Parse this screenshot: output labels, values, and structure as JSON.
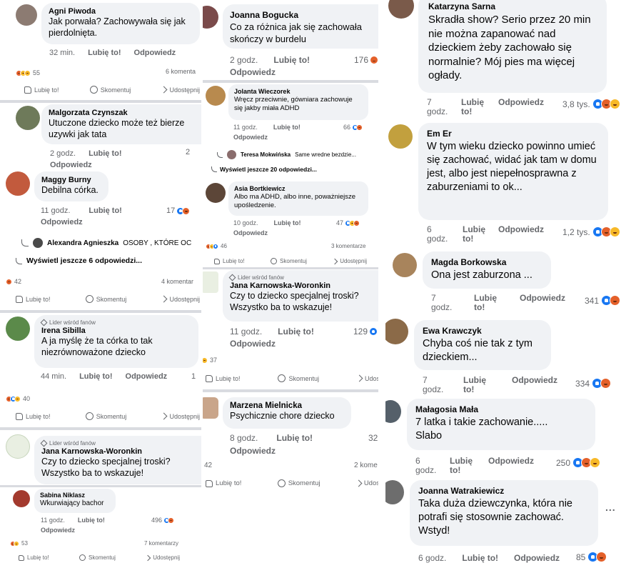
{
  "common": {
    "like_label": "Lubię to!",
    "reply_label": "Odpowiedz",
    "comment_label": "Skomentuj",
    "share_label": "Udostępnij",
    "fan_badge": "Lider wśród fanów"
  },
  "comments": {
    "agni": {
      "name": "Agni Piwoda",
      "text": "Jak porwała? Zachowywała się jak pierdolnięta.",
      "time": "32 min."
    },
    "malgorzata": {
      "name": "Malgorzata Czynszak",
      "text": "Utuczone dziecko może też bierze uzywki jak tata",
      "time": "2 godz."
    },
    "maggy": {
      "name": "Maggy Burny",
      "text": "Debilna córka.",
      "time": "11 godz.",
      "count": "17"
    },
    "alexandra": {
      "name": "Alexandra Agnieszka",
      "text": "OSOBY , KTÓRE OC"
    },
    "irena": {
      "name": "Irena Sibilla",
      "text": "A ja myślę że ta córka to tak niezrównoważone dziecko",
      "time": "44 min.",
      "count": "1"
    },
    "jana_left": {
      "name": "Jana Karnowska-Woronkin",
      "text": "Czy to dziecko specjalnej troski? Wszystko ba to wskazuje!"
    },
    "sabina": {
      "name": "Sabina Niklasz",
      "text": "Wkurwiający bachor",
      "time": "11 godz.",
      "count": "496"
    },
    "joanna_b": {
      "name": "Joanna Bogucka",
      "text": "Co za różnica jak się zachowała skończy w burdelu",
      "time": "2 godz.",
      "count": "176"
    },
    "jolanta": {
      "name": "Jolanta Wieczorek",
      "text": "Wręcz przeciwnie, gówniara zachowuje się jakby miała ADHD",
      "time": "11 godz.",
      "count": "66"
    },
    "teresa": {
      "name": "Teresa Mokwińska",
      "text": "Same wredne bezdzie..."
    },
    "asia": {
      "name": "Asia Bortkiewicz",
      "text": "Albo ma ADHD, albo inne, poważniejsze upośledzenie.",
      "time": "10 godz.",
      "count": "47"
    },
    "jana_mid": {
      "name": "Jana Karnowska-Woronkin",
      "text": "Czy to dziecko specjalnej troski? Wszystko ba to wskazuje!",
      "time": "11 godz.",
      "count": "129"
    },
    "marzena": {
      "name": "Marzena Mielnicka",
      "text": "Psychicznie chore dziecko",
      "time": "8 godz.",
      "count": "32"
    },
    "katarzyna": {
      "name": "Katarzyna Sarna",
      "text": "Skradła show? Serio przez 20 min nie można zapanować nad dzieckiem żeby zachowało się normalnie? Mój pies ma więcej ogłady.",
      "time_line1": "7",
      "time_line2": "godz.",
      "count": "3,8 tys."
    },
    "em": {
      "name": "Em Er",
      "text": "W tym wieku dziecko powinno umieć się zachować, widać jak tam w domu jest, albo jest niepełnosprawna z zaburzeniami to ok...",
      "time_line1": "6",
      "time_line2": "godz.",
      "count": "1,2 tys."
    },
    "magda": {
      "name": "Magda Borkowska",
      "text": "Ona jest zaburzona ...",
      "time_line1": "7",
      "time_line2": "godz.",
      "count": "341"
    },
    "ewa": {
      "name": "Ewa Krawczyk",
      "text": "Chyba coś nie tak z tym dzieckiem...",
      "time_line1": "7",
      "time_line2": "godz.",
      "count": "334"
    },
    "malagosia": {
      "name": "Małagosia Mała",
      "text": "7 latka i takie zachowanie..... Slabo",
      "time_line1": "6",
      "time_line2": "godz.",
      "count": "250"
    },
    "joanna_w": {
      "name": "Joanna Watrakiewicz",
      "text": "Taka duża dziewczynka, która nie potrafi się stosownie zachować. Wstyd!",
      "time": "6 godz.",
      "count": "85"
    }
  },
  "replies_like_line1": "Lubię",
  "replies_like_line2": "to!",
  "posts": {
    "p1": {
      "reactions": "55",
      "comments": "6 komenta"
    },
    "p2": {
      "reactions": "42",
      "comments": "4 komentar"
    },
    "p3": {
      "reactions": "40"
    },
    "p4": {
      "reactions": "53",
      "comments": "7 komentarzy"
    },
    "p5": {
      "reactions": "46",
      "comments": "3 komentarze"
    },
    "p6": {
      "reactions": "37"
    },
    "p7": {
      "reactions": "42",
      "comments": "2 kome"
    }
  },
  "view_more": {
    "left": "Wyświetl jeszcze 6 odpowiedzi...",
    "mid": "Wyświetl jeszcze 20 odpowiedzi..."
  },
  "more_options": "..."
}
